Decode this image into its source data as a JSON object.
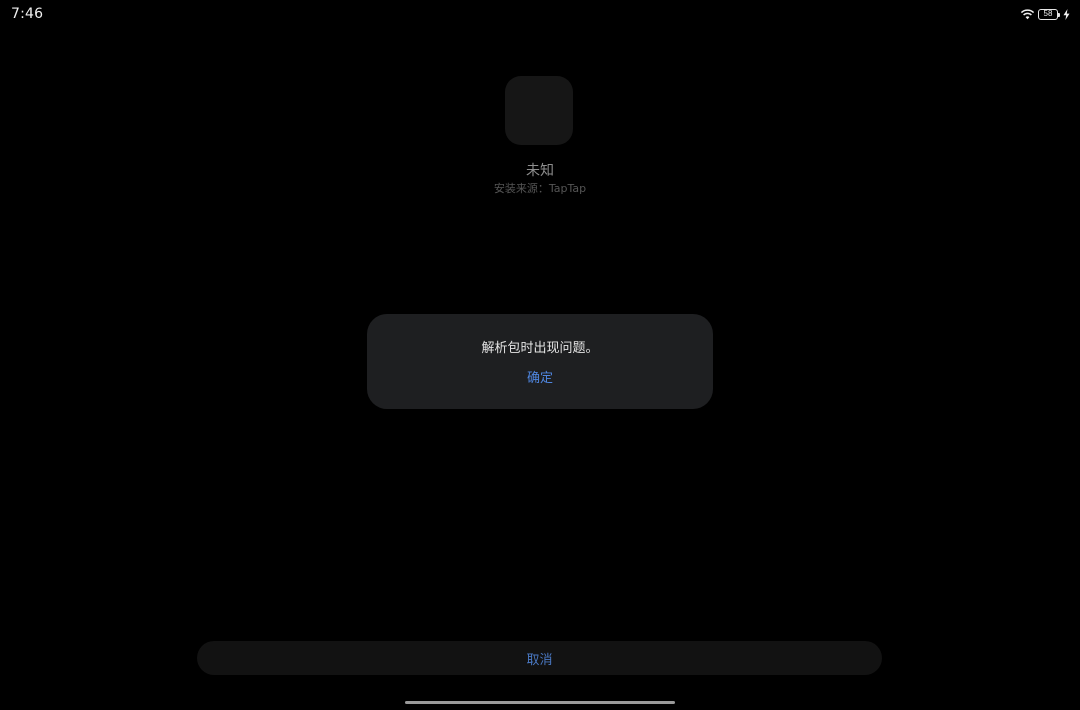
{
  "status_bar": {
    "time": "7:46",
    "battery_level": "58",
    "icons": [
      "wifi-icon",
      "battery-icon",
      "charging-bolt-icon"
    ]
  },
  "app": {
    "name": "未知",
    "install_source": "安装来源：TapTap"
  },
  "dialog": {
    "message": "解析包时出现问题。",
    "confirm_label": "确定"
  },
  "bottom_bar": {
    "cancel_label": "取消"
  },
  "colors": {
    "background": "#000000",
    "dialog_background": "#1e1f21",
    "accent": "#4f86e0"
  }
}
